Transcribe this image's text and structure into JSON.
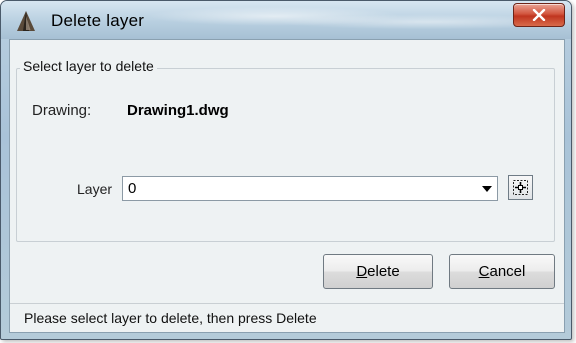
{
  "window": {
    "title": "Delete layer",
    "icon": "autocad-triangle-icon",
    "close_icon": "close-x-icon"
  },
  "group": {
    "legend": "Select layer to delete"
  },
  "drawing": {
    "label": "Drawing:",
    "value": "Drawing1.dwg"
  },
  "layer": {
    "label": "Layer",
    "selected": "0",
    "dropdown_icon": "chevron-down-icon",
    "pick_icon": "pick-layer-icon"
  },
  "buttons": {
    "delete_label": "Delete",
    "delete_mnemonic": "D",
    "delete_rest": "elete",
    "cancel_label": "Cancel",
    "cancel_mnemonic": "C",
    "cancel_rest": "ancel"
  },
  "status": {
    "text": "Please select layer to delete, then press Delete"
  },
  "colors": {
    "close_button": "#c0351f",
    "client_bg": "#eef2f3"
  }
}
